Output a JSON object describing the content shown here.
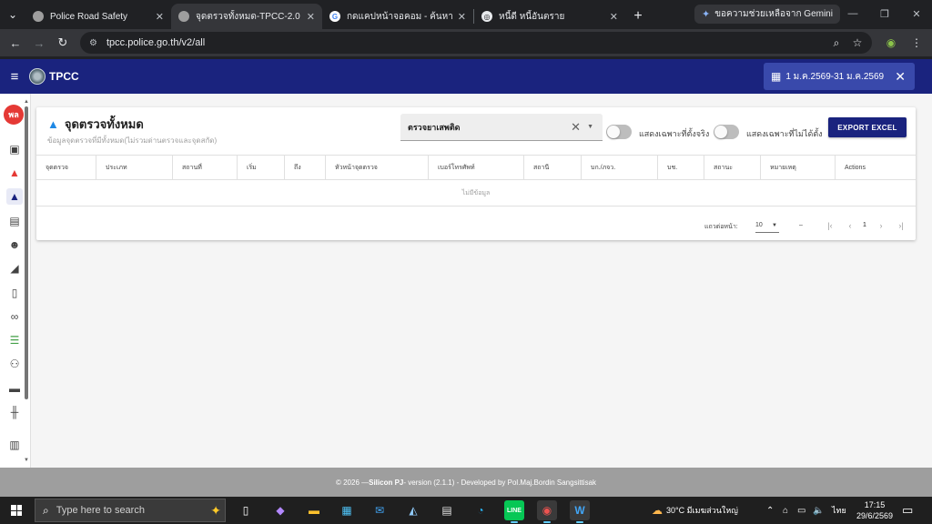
{
  "browser": {
    "tabs": [
      {
        "label": "Police Road Safety",
        "active": false,
        "favicon": "police-badge-icon"
      },
      {
        "label": "จุดตรวจทั้งหมด-TPCC-2.0",
        "active": true,
        "favicon": "police-badge-icon"
      },
      {
        "label": "กดแคปหน้าจอคอม - ค้นหาด้วย Google",
        "active": false,
        "favicon": "google-icon"
      },
      {
        "label": "หนี้ดี หนี้อันตราย",
        "active": false,
        "favicon": "chatgpt-icon"
      }
    ],
    "gemini_label": "ขอความช่วยเหลือจาก Gemini",
    "url": "tpcc.police.go.th/v2/all"
  },
  "app": {
    "title": "TPCC",
    "date_range": "1 ม.ค.2569-31 ม.ค.2569",
    "avatar_text": "พล"
  },
  "page": {
    "title": "จุดตรวจทั้งหมด",
    "subtitle": "ข้อมูลจุดตรวจที่มีทั้งหมด(ไม่รวมด่านตรวจและจุดสกัด)",
    "filter_value": "ตรวจยาเสพติด",
    "toggle1_label": "แสดงเฉพาะที่ตั้งจริง",
    "toggle2_label": "แสดงเฉพาะที่ไม่ได้ตั้ง",
    "export_label": "EXPORT EXCEL"
  },
  "table": {
    "columns": [
      "จุดตรวจ",
      "ประเภท",
      "สถานที่",
      "เริ่ม",
      "ถึง",
      "หัวหน้าจุดตรวจ",
      "เบอร์โทรศัพท์",
      "สถานี",
      "บก./ภจว.",
      "บช.",
      "สถานะ",
      "หมายเหตุ",
      "Actions"
    ],
    "empty_text": "ไม่มีข้อมูล",
    "rows_per_page_label": "แถวต่อหน้า:",
    "rows_per_page": "10",
    "range_text": "–",
    "current_page": "1"
  },
  "footer": {
    "prefix": "© 2026 — ",
    "brand": "Silicon PJ",
    "suffix": " - version (2.1.1) - Developed by Pol.Maj.Bordin Sangsittisak"
  },
  "taskbar": {
    "search_placeholder": "Type here to search",
    "weather": "30°C  มีเมฆส่วนใหญ่",
    "language": "ไทย",
    "time": "17:15",
    "date": "29/6/2569"
  }
}
